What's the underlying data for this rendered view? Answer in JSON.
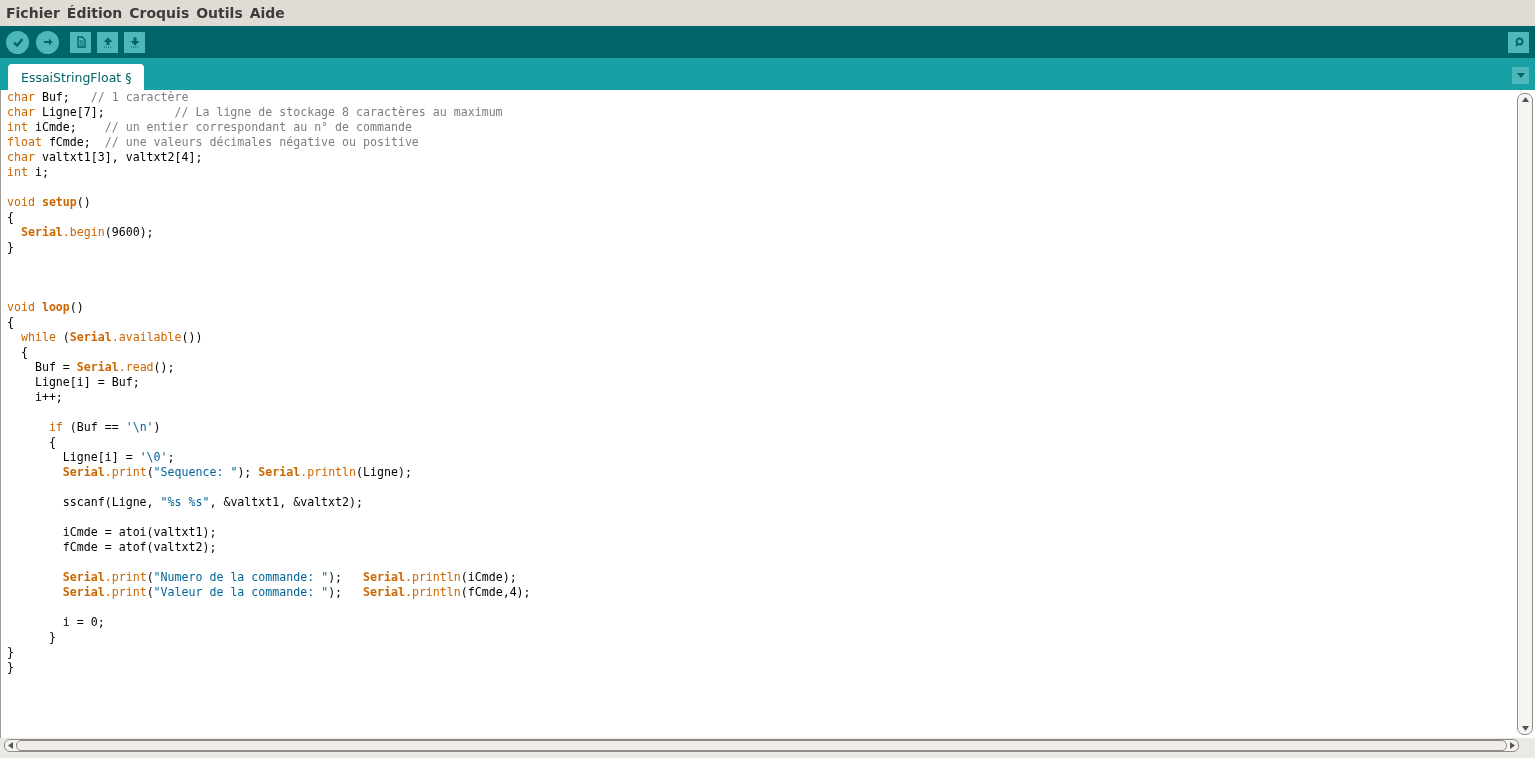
{
  "menu": [
    {
      "label": "Fichier"
    },
    {
      "label": "Édition"
    },
    {
      "label": "Croquis"
    },
    {
      "label": "Outils"
    },
    {
      "label": "Aide"
    }
  ],
  "tabs": [
    {
      "label": "EssaiStringFloat §",
      "selected": true
    }
  ],
  "lines": [
    {
      "kind": "code",
      "tokens": [
        {
          "kind": "keyword",
          "text": "char"
        },
        {
          "kind": "plain",
          "text": " Buf;   "
        },
        {
          "kind": "comment",
          "text": "// 1 caractère"
        }
      ]
    },
    {
      "kind": "code",
      "tokens": [
        {
          "kind": "keyword",
          "text": "char"
        },
        {
          "kind": "plain",
          "text": " Ligne[7];          "
        },
        {
          "kind": "comment",
          "text": "// La ligne de stockage 8 caractères au maximum"
        }
      ]
    },
    {
      "kind": "code",
      "tokens": [
        {
          "kind": "keyword",
          "text": "int"
        },
        {
          "kind": "plain",
          "text": " iCmde;    "
        },
        {
          "kind": "comment",
          "text": "// un entier correspondant au n° de commande"
        }
      ]
    },
    {
      "kind": "code",
      "tokens": [
        {
          "kind": "keyword",
          "text": "float"
        },
        {
          "kind": "plain",
          "text": " fCmde;  "
        },
        {
          "kind": "comment",
          "text": "// une valeurs décimales négative ou positive"
        }
      ]
    },
    {
      "kind": "code",
      "tokens": [
        {
          "kind": "keyword",
          "text": "char"
        },
        {
          "kind": "plain",
          "text": " valtxt1[3], valtxt2[4];"
        }
      ]
    },
    {
      "kind": "code",
      "tokens": [
        {
          "kind": "keyword",
          "text": "int"
        },
        {
          "kind": "plain",
          "text": " i;"
        }
      ]
    },
    {
      "kind": "blank"
    },
    {
      "kind": "code",
      "tokens": [
        {
          "kind": "keyword",
          "text": "void "
        },
        {
          "kind": "function",
          "text": "setup"
        },
        {
          "kind": "plain",
          "text": "()"
        }
      ]
    },
    {
      "kind": "code",
      "tokens": [
        {
          "kind": "plain",
          "text": "{"
        }
      ]
    },
    {
      "kind": "code",
      "tokens": [
        {
          "kind": "function",
          "text": "  Serial"
        },
        {
          "kind": "method",
          "text": ".begin"
        },
        {
          "kind": "plain",
          "text": "(9600);"
        }
      ]
    },
    {
      "kind": "code",
      "tokens": [
        {
          "kind": "plain",
          "text": "}"
        }
      ]
    },
    {
      "kind": "blank"
    },
    {
      "kind": "blank"
    },
    {
      "kind": "blank"
    },
    {
      "kind": "code",
      "tokens": [
        {
          "kind": "keyword",
          "text": "void "
        },
        {
          "kind": "function",
          "text": "loop"
        },
        {
          "kind": "plain",
          "text": "()"
        }
      ]
    },
    {
      "kind": "code",
      "tokens": [
        {
          "kind": "plain",
          "text": "{"
        }
      ]
    },
    {
      "kind": "code",
      "tokens": [
        {
          "kind": "keyword",
          "text": "  while"
        },
        {
          "kind": "plain",
          "text": " ("
        },
        {
          "kind": "function",
          "text": "Serial"
        },
        {
          "kind": "method",
          "text": ".available"
        },
        {
          "kind": "plain",
          "text": "())"
        }
      ]
    },
    {
      "kind": "code",
      "tokens": [
        {
          "kind": "plain",
          "text": "  {"
        }
      ]
    },
    {
      "kind": "code",
      "tokens": [
        {
          "kind": "plain",
          "text": "    Buf = "
        },
        {
          "kind": "function",
          "text": "Serial"
        },
        {
          "kind": "method",
          "text": ".read"
        },
        {
          "kind": "plain",
          "text": "();"
        }
      ]
    },
    {
      "kind": "code",
      "tokens": [
        {
          "kind": "plain",
          "text": "    Ligne[i] = Buf;"
        }
      ]
    },
    {
      "kind": "code",
      "tokens": [
        {
          "kind": "plain",
          "text": "    i++;"
        }
      ]
    },
    {
      "kind": "blank"
    },
    {
      "kind": "code",
      "tokens": [
        {
          "kind": "keyword",
          "text": "      if"
        },
        {
          "kind": "plain",
          "text": " (Buf == "
        },
        {
          "kind": "string",
          "text": "'\\n'"
        },
        {
          "kind": "plain",
          "text": ")"
        }
      ]
    },
    {
      "kind": "code",
      "tokens": [
        {
          "kind": "plain",
          "text": "      {"
        }
      ]
    },
    {
      "kind": "code",
      "tokens": [
        {
          "kind": "plain",
          "text": "        Ligne[i] = "
        },
        {
          "kind": "string",
          "text": "'\\0'"
        },
        {
          "kind": "plain",
          "text": ";"
        }
      ]
    },
    {
      "kind": "code",
      "tokens": [
        {
          "kind": "function",
          "text": "        Serial"
        },
        {
          "kind": "method",
          "text": ".print"
        },
        {
          "kind": "plain",
          "text": "("
        },
        {
          "kind": "string",
          "text": "\"Sequence: \""
        },
        {
          "kind": "plain",
          "text": "); "
        },
        {
          "kind": "function",
          "text": "Serial"
        },
        {
          "kind": "method",
          "text": ".println"
        },
        {
          "kind": "plain",
          "text": "(Ligne);"
        }
      ]
    },
    {
      "kind": "blank"
    },
    {
      "kind": "code",
      "tokens": [
        {
          "kind": "plain",
          "text": "        sscanf(Ligne, "
        },
        {
          "kind": "string",
          "text": "\"%s %s\""
        },
        {
          "kind": "plain",
          "text": ", &valtxt1, &valtxt2);"
        }
      ]
    },
    {
      "kind": "blank"
    },
    {
      "kind": "code",
      "tokens": [
        {
          "kind": "plain",
          "text": "        iCmde = atoi(valtxt1);"
        }
      ]
    },
    {
      "kind": "code",
      "tokens": [
        {
          "kind": "plain",
          "text": "        fCmde = atof(valtxt2);"
        }
      ]
    },
    {
      "kind": "blank"
    },
    {
      "kind": "code",
      "tokens": [
        {
          "kind": "function",
          "text": "        Serial"
        },
        {
          "kind": "method",
          "text": ".print"
        },
        {
          "kind": "plain",
          "text": "("
        },
        {
          "kind": "string",
          "text": "\"Numero de la commande: \""
        },
        {
          "kind": "plain",
          "text": ");   "
        },
        {
          "kind": "function",
          "text": "Serial"
        },
        {
          "kind": "method",
          "text": ".println"
        },
        {
          "kind": "plain",
          "text": "(iCmde);"
        }
      ]
    },
    {
      "kind": "code",
      "tokens": [
        {
          "kind": "function",
          "text": "        Serial"
        },
        {
          "kind": "method",
          "text": ".print"
        },
        {
          "kind": "plain",
          "text": "("
        },
        {
          "kind": "string",
          "text": "\"Valeur de la commande: \""
        },
        {
          "kind": "plain",
          "text": ");   "
        },
        {
          "kind": "function",
          "text": "Serial"
        },
        {
          "kind": "method",
          "text": ".println"
        },
        {
          "kind": "plain",
          "text": "(fCmde,4);"
        }
      ]
    },
    {
      "kind": "blank"
    },
    {
      "kind": "code",
      "tokens": [
        {
          "kind": "plain",
          "text": "        i = 0;"
        }
      ]
    },
    {
      "kind": "code",
      "tokens": [
        {
          "kind": "plain",
          "text": "      }"
        }
      ]
    },
    {
      "kind": "code",
      "tokens": [
        {
          "kind": "plain",
          "text": "}"
        }
      ]
    },
    {
      "kind": "code",
      "tokens": [
        {
          "kind": "plain",
          "text": "}"
        }
      ]
    }
  ]
}
